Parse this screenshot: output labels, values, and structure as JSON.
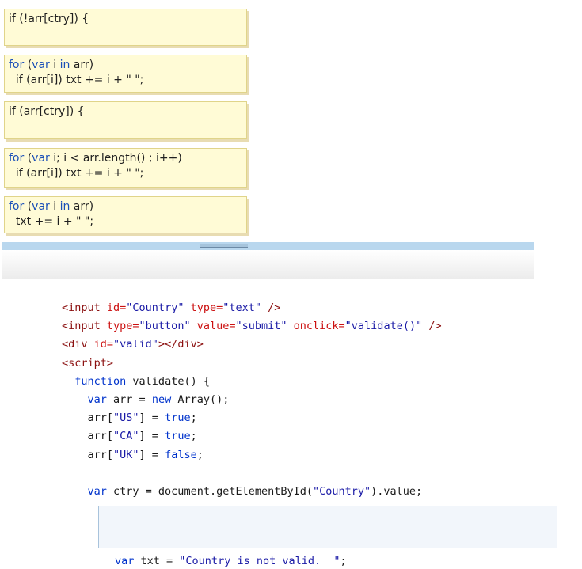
{
  "answer_tiles": [
    {
      "lines": [
        [
          {
            "t": "if (!arr[ctry]) {",
            "k": ""
          }
        ]
      ]
    },
    {
      "lines": [
        [
          {
            "t": "for",
            "k": "kw"
          },
          {
            "t": " (",
            "k": ""
          },
          {
            "t": "var",
            "k": "kw"
          },
          {
            "t": " i ",
            "k": ""
          },
          {
            "t": "in",
            "k": "kw"
          },
          {
            "t": " arr)",
            "k": ""
          }
        ],
        [
          {
            "t": "  if (arr[i]) txt += i + \" \";",
            "k": ""
          }
        ]
      ]
    },
    {
      "lines": [
        [
          {
            "t": "if (arr[ctry]) {",
            "k": ""
          }
        ]
      ]
    },
    {
      "lines": [
        [
          {
            "t": "for",
            "k": "kw"
          },
          {
            "t": " (",
            "k": ""
          },
          {
            "t": "var",
            "k": "kw"
          },
          {
            "t": " i; i < arr.length() ; i++)",
            "k": ""
          }
        ],
        [
          {
            "t": "  if (arr[i]) txt += i + \" \";",
            "k": ""
          }
        ]
      ]
    },
    {
      "lines": [
        [
          {
            "t": "for",
            "k": "kw"
          },
          {
            "t": " (",
            "k": ""
          },
          {
            "t": "var",
            "k": "kw"
          },
          {
            "t": " i ",
            "k": ""
          },
          {
            "t": "in",
            "k": "kw"
          },
          {
            "t": " arr)",
            "k": ""
          }
        ],
        [
          {
            "t": "  txt += i + \" \";",
            "k": ""
          }
        ]
      ]
    }
  ],
  "code_lines": [
    [
      {
        "t": "<input ",
        "k": "tag"
      },
      {
        "t": "id=",
        "k": "attr"
      },
      {
        "t": "\"Country\"",
        "k": "str"
      },
      {
        "t": " type=",
        "k": "attr"
      },
      {
        "t": "\"text\"",
        "k": "str"
      },
      {
        "t": " />",
        "k": "tag"
      }
    ],
    [
      {
        "t": "<input ",
        "k": "tag"
      },
      {
        "t": "type=",
        "k": "attr"
      },
      {
        "t": "\"button\"",
        "k": "str"
      },
      {
        "t": " value=",
        "k": "attr"
      },
      {
        "t": "\"submit\"",
        "k": "str"
      },
      {
        "t": " onclick=",
        "k": "attr"
      },
      {
        "t": "\"validate()\"",
        "k": "str"
      },
      {
        "t": " />",
        "k": "tag"
      }
    ],
    [
      {
        "t": "<div ",
        "k": "tag"
      },
      {
        "t": "id=",
        "k": "attr"
      },
      {
        "t": "\"valid\"",
        "k": "str"
      },
      {
        "t": "></div>",
        "k": "tag"
      }
    ],
    [
      {
        "t": "<script>",
        "k": "tag"
      }
    ],
    [
      {
        "t": "  ",
        "k": ""
      },
      {
        "t": "function",
        "k": "key"
      },
      {
        "t": " validate() {",
        "k": ""
      }
    ],
    [
      {
        "t": "    ",
        "k": ""
      },
      {
        "t": "var",
        "k": "key"
      },
      {
        "t": " arr = ",
        "k": ""
      },
      {
        "t": "new",
        "k": "key"
      },
      {
        "t": " Array();",
        "k": ""
      }
    ],
    [
      {
        "t": "    arr[",
        "k": ""
      },
      {
        "t": "\"US\"",
        "k": "str"
      },
      {
        "t": "] = ",
        "k": ""
      },
      {
        "t": "true",
        "k": "key"
      },
      {
        "t": ";",
        "k": ""
      }
    ],
    [
      {
        "t": "    arr[",
        "k": ""
      },
      {
        "t": "\"CA\"",
        "k": "str"
      },
      {
        "t": "] = ",
        "k": ""
      },
      {
        "t": "true",
        "k": "key"
      },
      {
        "t": ";",
        "k": ""
      }
    ],
    [
      {
        "t": "    arr[",
        "k": ""
      },
      {
        "t": "\"UK\"",
        "k": "str"
      },
      {
        "t": "] = ",
        "k": ""
      },
      {
        "t": "false",
        "k": "key"
      },
      {
        "t": ";",
        "k": ""
      }
    ],
    [],
    [
      {
        "t": "    ",
        "k": ""
      },
      {
        "t": "var",
        "k": "key"
      },
      {
        "t": " ctry = document.getElementById(",
        "k": ""
      },
      {
        "t": "\"Country\"",
        "k": "str"
      },
      {
        "t": ").value;",
        "k": ""
      }
    ]
  ],
  "cut_line": [
    {
      "t": "var",
      "k": "key"
    },
    {
      "t": " txt = ",
      "k": ""
    },
    {
      "t": "\"Country is not valid.  \"",
      "k": "str"
    },
    {
      "t": ";",
      "k": ""
    }
  ]
}
